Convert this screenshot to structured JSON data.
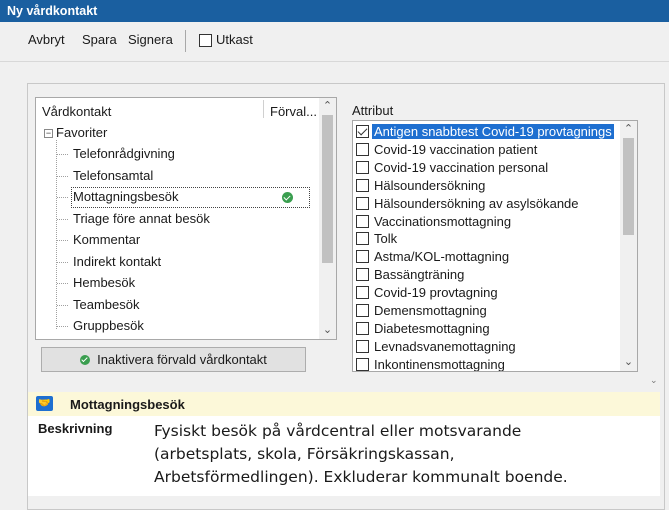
{
  "window": {
    "title": "Ny vårdkontakt"
  },
  "toolbar": {
    "cancel_label": "Avbryt",
    "save_label": "Spara",
    "sign_label": "Signera",
    "draft_label": "Utkast",
    "draft_checked": false
  },
  "tree": {
    "col_name": "Vårdkontakt",
    "col_default": "Förval...",
    "group": "Favoriter",
    "items": [
      {
        "label": "Telefonrådgivning"
      },
      {
        "label": "Telefonsamtal"
      },
      {
        "label": "Mottagningsbesök",
        "selected": true,
        "default": true
      },
      {
        "label": "Triage före annat besök"
      },
      {
        "label": "Kommentar"
      },
      {
        "label": "Indirekt kontakt"
      },
      {
        "label": "Hembesök"
      },
      {
        "label": "Teambesök"
      },
      {
        "label": "Gruppbesök"
      }
    ]
  },
  "deactivate_button": {
    "label": "Inaktivera förvald vårdkontakt"
  },
  "attributes": {
    "title": "Attribut",
    "items": [
      {
        "label": "Antigen snabbtest Covid-19 provtagnings",
        "checked": true,
        "selected": true
      },
      {
        "label": "Covid-19 vaccination patient",
        "checked": false
      },
      {
        "label": "Covid-19 vaccination personal",
        "checked": false
      },
      {
        "label": "Hälsoundersökning",
        "checked": false
      },
      {
        "label": "Hälsoundersökning av asylsökande",
        "checked": false
      },
      {
        "label": "Vaccinationsmottagning",
        "checked": false
      },
      {
        "label": "Tolk",
        "checked": false
      },
      {
        "label": "Astma/KOL-mottagning",
        "checked": false
      },
      {
        "label": "Bassängträning",
        "checked": false
      },
      {
        "label": "Covid-19 provtagning",
        "checked": false
      },
      {
        "label": "Demensmottagning",
        "checked": false
      },
      {
        "label": "Diabetesmottagning",
        "checked": false
      },
      {
        "label": "Levnadsvanemottagning",
        "checked": false
      },
      {
        "label": "Inkontinensmottagning",
        "checked": false
      }
    ]
  },
  "info": {
    "title": "Mottagningsbesök",
    "icon": "handshake-icon",
    "desc_label": "Beskrivning",
    "desc_lines": [
      "Fysiskt besök på vårdcentral eller motsvarande",
      "(arbetsplats, skola, Försäkringskassan,",
      "Arbetsförmedlingen). Exkluderar kommunalt boende."
    ]
  },
  "colors": {
    "title_bar": "#1a5fa0",
    "selection": "#1e6fd0",
    "info_header_bg": "#fcf8d9",
    "default_check": "#3a9e4f"
  }
}
